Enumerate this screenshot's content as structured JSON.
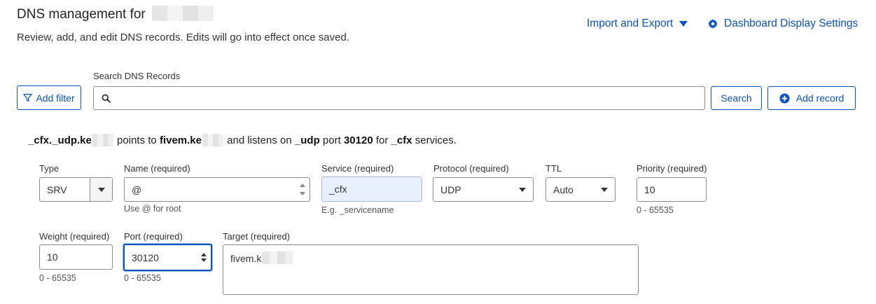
{
  "header": {
    "title": "DNS management for",
    "subtitle": "Review, add, and edit DNS records. Edits will go into effect once saved.",
    "import_export_label": "Import and Export",
    "dashboard_settings_label": "Dashboard Display Settings"
  },
  "search": {
    "label": "Search DNS Records",
    "value": "",
    "add_filter_label": "Add filter",
    "search_button_label": "Search",
    "add_record_label": "Add record"
  },
  "summary": {
    "name_prefix": "_cfx._udp.ke",
    "points_to_text": "points to",
    "target_prefix": "fivem.ke",
    "listens_on_text": "and listens on",
    "protocol": "_udp",
    "port_text": "port",
    "port": "30120",
    "for_text": "for",
    "service": "_cfx",
    "services_text": "services."
  },
  "form": {
    "type": {
      "label": "Type",
      "value": "SRV"
    },
    "name": {
      "label": "Name (required)",
      "value": "@",
      "hint": "Use @ for root"
    },
    "service": {
      "label": "Service (required)",
      "value": "_cfx",
      "hint": "E.g. _servicename"
    },
    "protocol": {
      "label": "Protocol (required)",
      "value": "UDP"
    },
    "ttl": {
      "label": "TTL",
      "value": "Auto"
    },
    "priority": {
      "label": "Priority (required)",
      "value": "10",
      "hint": "0 - 65535"
    },
    "weight": {
      "label": "Weight (required)",
      "value": "10",
      "hint": "0 - 65535"
    },
    "port": {
      "label": "Port (required)",
      "value": "30120",
      "hint": "0 - 65535"
    },
    "target": {
      "label": "Target (required)",
      "value": "fivem.k"
    }
  },
  "colors": {
    "accent": "#0a51c2",
    "service_field_bg": "#e8effd"
  },
  "icons": [
    "caret-down-icon",
    "gear-icon",
    "filter-icon",
    "search-icon",
    "plus-circle-icon"
  ]
}
